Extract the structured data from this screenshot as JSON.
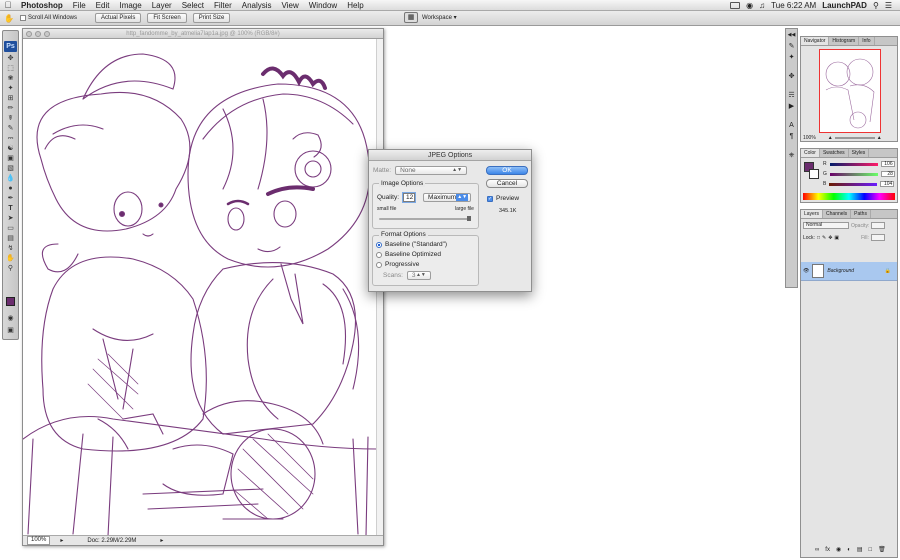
{
  "menubar": {
    "app": "Photoshop",
    "items": [
      "File",
      "Edit",
      "Image",
      "Layer",
      "Select",
      "Filter",
      "Analysis",
      "View",
      "Window",
      "Help"
    ],
    "clock": "Tue 6:22 AM",
    "user": "LaunchPAD"
  },
  "options": {
    "scroll_all": "Scroll All Windows",
    "actual_pixels": "Actual Pixels",
    "fit_screen": "Fit Screen",
    "print_size": "Print Size",
    "workspace": "Workspace"
  },
  "toolbox": {
    "logo": "Ps",
    "fg_color": "#6b2d6e"
  },
  "document": {
    "title": "http_fandomme_by_atmelia7lap1a.jpg @ 100% (RGB/8#)",
    "zoom": "100%",
    "doc_size": "Doc: 2.29M/2.29M"
  },
  "jpeg": {
    "title": "JPEG Options",
    "matte_label": "Matte:",
    "matte_value": "None",
    "image_options": "Image Options",
    "quality_label": "Quality:",
    "quality_value": "12",
    "quality_preset": "Maximum",
    "small_file": "small file",
    "large_file": "large file",
    "quality_fraction": 1.0,
    "format_options": "Format Options",
    "formats": [
      "Baseline (\"Standard\")",
      "Baseline Optimized",
      "Progressive"
    ],
    "selected_format": 0,
    "scans_label": "Scans:",
    "scans_value": "3",
    "ok": "OK",
    "cancel": "Cancel",
    "preview": "Preview",
    "file_size": "345.1K"
  },
  "navigator": {
    "tabs": [
      "Navigator",
      "Histogram",
      "Info"
    ],
    "zoom": "100%"
  },
  "color": {
    "tabs": [
      "Color",
      "Swatches",
      "Styles"
    ],
    "r": "106",
    "g": "28",
    "b": "104",
    "r_label": "R",
    "g_label": "G",
    "b_label": "B"
  },
  "layers": {
    "tabs": [
      "Layers",
      "Channels",
      "Paths"
    ],
    "blend": "Normal",
    "opacity_label": "Opacity:",
    "lock_label": "Lock:",
    "fill_label": "Fill:",
    "layer_name": "Background"
  }
}
